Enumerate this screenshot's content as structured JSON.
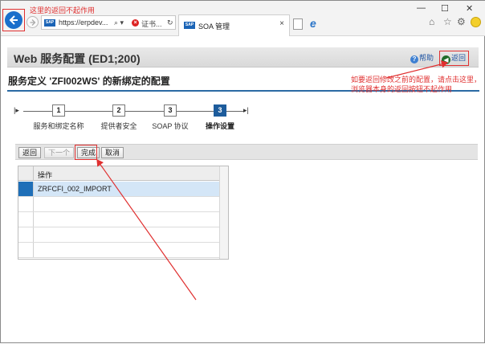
{
  "browser": {
    "annotation_top": "这里的返回不起作用",
    "address_url": "https://erpdev...",
    "address_controls": [
      "⌕ ▾",
      "×"
    ],
    "cert_label": "证书...",
    "refresh_glyph": "↻",
    "tab_logo": "SAP",
    "tab_title": "SOA 管理",
    "tab_close": "×",
    "window_controls": [
      "—",
      "☐",
      "✕"
    ],
    "toolbar_icons": [
      "⌂",
      "☆",
      "⚙"
    ]
  },
  "page": {
    "title": "Web 服务配置 (ED1;200)",
    "help_label": "帮助",
    "back_label": "返回",
    "subtitle": "服务定义 'ZFI002WS' 的新绑定的配置",
    "annotation_right": "如要返回修改之前的配置，请点击这里，浏览器本身的返回按钮不起作用"
  },
  "roadmap": {
    "steps": [
      {
        "number": "1",
        "label": "服务和绑定名称",
        "active": false
      },
      {
        "number": "2",
        "label": "提供者安全",
        "active": false
      },
      {
        "number": "3",
        "label": "SOAP 协议",
        "active": false
      },
      {
        "number": "3",
        "label": "操作设置",
        "active": true
      }
    ]
  },
  "toolbar": {
    "back": "返回",
    "next": "下一个",
    "finish": "完成",
    "cancel": "取消"
  },
  "table": {
    "header": "操作",
    "rows": [
      "ZRFCFI_002_IMPORT",
      "",
      "",
      "",
      ""
    ],
    "selected_row": 0
  },
  "colors": {
    "annotation": "#e03030",
    "accent": "#1d5c9c",
    "link": "#2055a3"
  }
}
